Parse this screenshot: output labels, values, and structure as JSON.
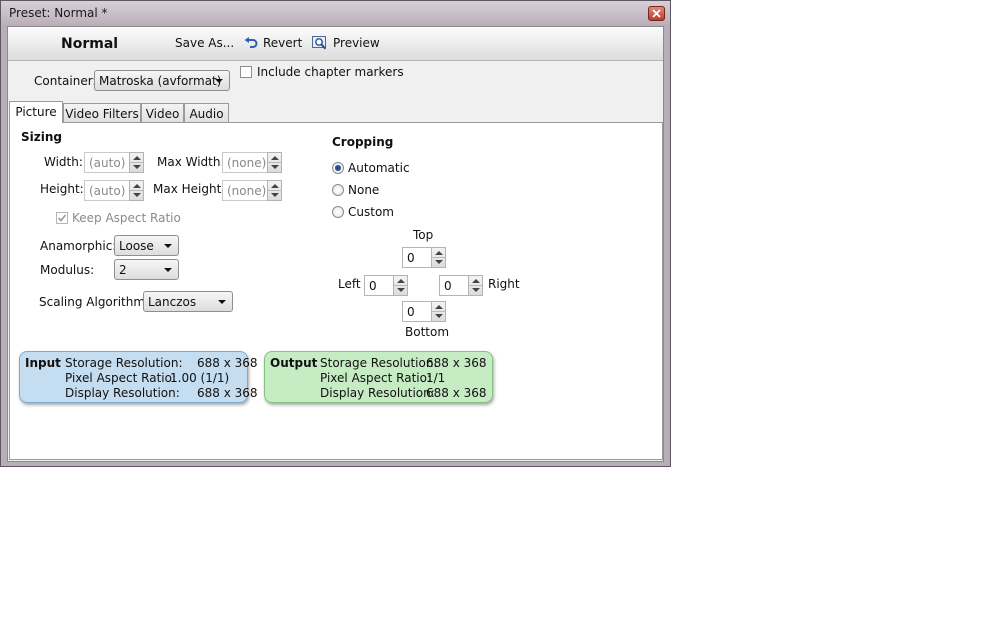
{
  "window": {
    "title": "Preset: Normal *"
  },
  "toolbar": {
    "preset_name": "Normal",
    "save_as": "Save As...",
    "revert": "Revert",
    "preview": "Preview"
  },
  "container": {
    "label": "Container:",
    "value": "Matroska (avformat)",
    "chapter_markers_label": "Include chapter markers",
    "chapter_markers_checked": false
  },
  "tabs": [
    {
      "label": "Picture",
      "active": true
    },
    {
      "label": "Video Filters",
      "active": false
    },
    {
      "label": "Video",
      "active": false
    },
    {
      "label": "Audio",
      "active": false
    }
  ],
  "sizing": {
    "heading": "Sizing",
    "width_label": "Width:",
    "width_value": "(auto)",
    "max_width_label": "Max Width:",
    "max_width_value": "(none)",
    "height_label": "Height:",
    "height_value": "(auto)",
    "max_height_label": "Max Height:",
    "max_height_value": "(none)",
    "keep_aspect_label": "Keep Aspect Ratio",
    "keep_aspect_checked": true,
    "anamorphic_label": "Anamorphic:",
    "anamorphic_value": "Loose",
    "modulus_label": "Modulus:",
    "modulus_value": "2",
    "scaling_label": "Scaling Algorithm:",
    "scaling_value": "Lanczos"
  },
  "cropping": {
    "heading": "Cropping",
    "options": [
      "Automatic",
      "None",
      "Custom"
    ],
    "selected": "Automatic",
    "top_label": "Top",
    "top_value": "0",
    "left_label": "Left",
    "left_value": "0",
    "right_label": "Right",
    "right_value": "0",
    "bottom_label": "Bottom",
    "bottom_value": "0"
  },
  "input_box": {
    "title": "Input",
    "storage_label": "Storage Resolution:",
    "storage_value": "688 x 368",
    "par_label": "Pixel Aspect Ratio:",
    "par_value": "1.00 (1/1)",
    "display_label": "Display Resolution:",
    "display_value": "688 x 368",
    "color": "#c5ddf0"
  },
  "output_box": {
    "title": "Output",
    "storage_label": "Storage Resolution:",
    "storage_value": "688 x 368",
    "par_label": "Pixel Aspect Ratio:",
    "par_value": "1/1",
    "display_label": "Display Resolution:",
    "display_value": "688 x 368",
    "color": "#c6ecc4"
  }
}
